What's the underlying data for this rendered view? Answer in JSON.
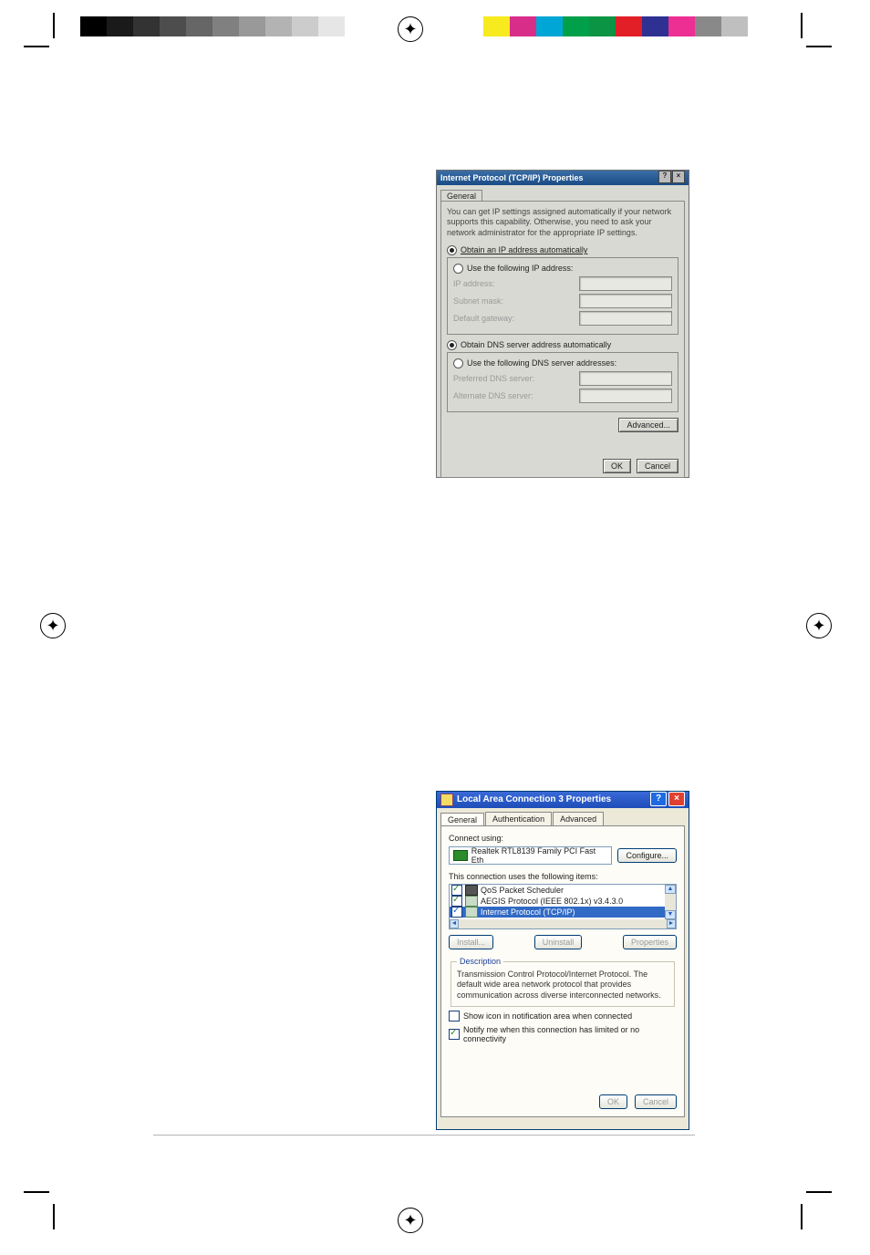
{
  "colorbar_left": [
    "#000000",
    "#1a1a1a",
    "#333333",
    "#4d4d4d",
    "#666666",
    "#808080",
    "#999999",
    "#b3b3b3",
    "#cccccc",
    "#e6e6e6"
  ],
  "colorbar_right": [
    "#f7ea1e",
    "#d82e8a",
    "#00a6d6",
    "#00a04a",
    "#0b9444",
    "#e21e26",
    "#2e3192",
    "#ed2f93",
    "#898989",
    "#bfbfbf"
  ],
  "dlg1": {
    "title": "Internet Protocol (TCP/IP) Properties",
    "help": "?",
    "close": "×",
    "tab_general": "General",
    "message": "You can get IP settings assigned automatically if your network supports this capability. Otherwise, you need to ask your network administrator for the appropriate IP settings.",
    "radio_auto_ip": "Obtain an IP address automatically",
    "radio_manual_ip": "Use the following IP address:",
    "lbl_ip": "IP address:",
    "lbl_subnet": "Subnet mask:",
    "lbl_gateway": "Default gateway:",
    "radio_auto_dns": "Obtain DNS server address automatically",
    "radio_manual_dns": "Use the following DNS server addresses:",
    "lbl_pref_dns": "Preferred DNS server:",
    "lbl_alt_dns": "Alternate DNS server:",
    "advanced": "Advanced...",
    "ok": "OK",
    "cancel": "Cancel"
  },
  "dlg2": {
    "title": "Local Area Connection 3 Properties",
    "help": "?",
    "close": "×",
    "tab_general": "General",
    "tab_auth": "Authentication",
    "tab_adv": "Advanced",
    "connect_using": "Connect using:",
    "device": "Realtek RTL8139 Family PCI Fast Eth",
    "configure": "Configure...",
    "uses_items": "This connection uses the following items:",
    "item_qos": "QoS Packet Scheduler",
    "item_aegis": "AEGIS Protocol (IEEE 802.1x) v3.4.3.0",
    "item_tcpip": "Internet Protocol (TCP/IP)",
    "install": "Install...",
    "uninstall": "Uninstall",
    "properties": "Properties",
    "desc_legend": "Description",
    "desc_text": "Transmission Control Protocol/Internet Protocol. The default wide area network protocol that provides communication across diverse interconnected networks.",
    "show_icon": "Show icon in notification area when connected",
    "notify_limited": "Notify me when this connection has limited or no connectivity",
    "ok": "OK",
    "cancel": "Cancel"
  }
}
